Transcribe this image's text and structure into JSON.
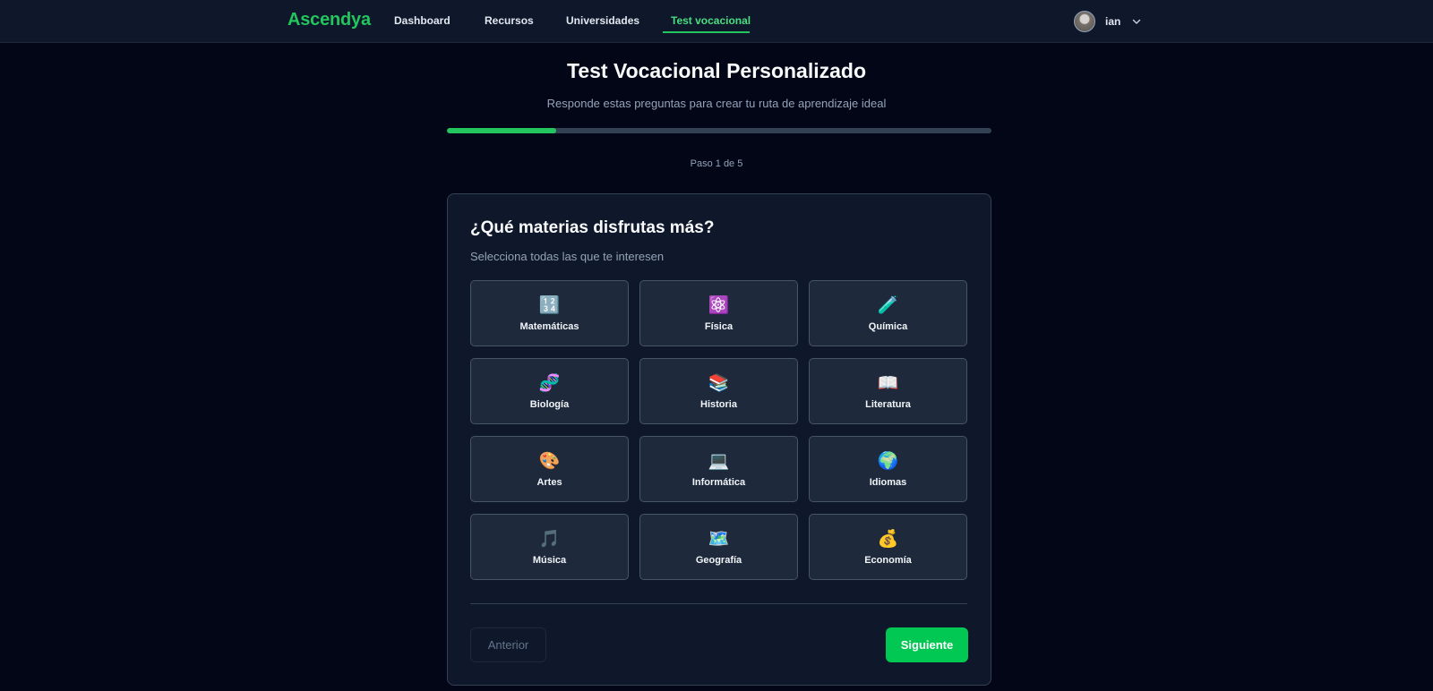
{
  "navbar": {
    "brand": "Ascendya",
    "links": [
      {
        "label": "Dashboard",
        "active": false
      },
      {
        "label": "Recursos",
        "active": false
      },
      {
        "label": "Universidades",
        "active": false
      },
      {
        "label": "Test vocacional",
        "active": true
      }
    ],
    "user": {
      "name": "ian",
      "icon": "avatar"
    }
  },
  "header": {
    "title": "Test Vocacional Personalizado",
    "subtitle": "Responde estas preguntas para crear tu ruta de aprendizaje ideal",
    "progress": 0.2,
    "step_text": "Paso 1 de 5"
  },
  "question": {
    "title": "¿Qué materias disfrutas más?",
    "subtitle": "Selecciona todas las que te interesen",
    "options": [
      {
        "label": "Matemáticas",
        "icon": "🔢",
        "icon_name": "numbers-icon"
      },
      {
        "label": "Física",
        "icon": "⚛️",
        "icon_name": "atom-icon"
      },
      {
        "label": "Química",
        "icon": "🧪",
        "icon_name": "test-tube-icon"
      },
      {
        "label": "Biología",
        "icon": "🧬",
        "icon_name": "dna-icon"
      },
      {
        "label": "Historia",
        "icon": "📚",
        "icon_name": "books-icon"
      },
      {
        "label": "Literatura",
        "icon": "📖",
        "icon_name": "open-book-icon"
      },
      {
        "label": "Artes",
        "icon": "🎨",
        "icon_name": "palette-icon"
      },
      {
        "label": "Informática",
        "icon": "💻",
        "icon_name": "laptop-icon"
      },
      {
        "label": "Idiomas",
        "icon": "🌍",
        "icon_name": "globe-icon"
      },
      {
        "label": "Música",
        "icon": "🎵",
        "icon_name": "music-note-icon"
      },
      {
        "label": "Geografía",
        "icon": "🗺️",
        "icon_name": "map-icon"
      },
      {
        "label": "Economía",
        "icon": "💰",
        "icon_name": "money-bag-icon"
      }
    ]
  },
  "buttons": {
    "previous": "Anterior",
    "next": "Siguiente"
  },
  "colors": {
    "accent": "#22c55e",
    "background": "#020617",
    "card": "#0f172a",
    "option": "#1e293b"
  }
}
